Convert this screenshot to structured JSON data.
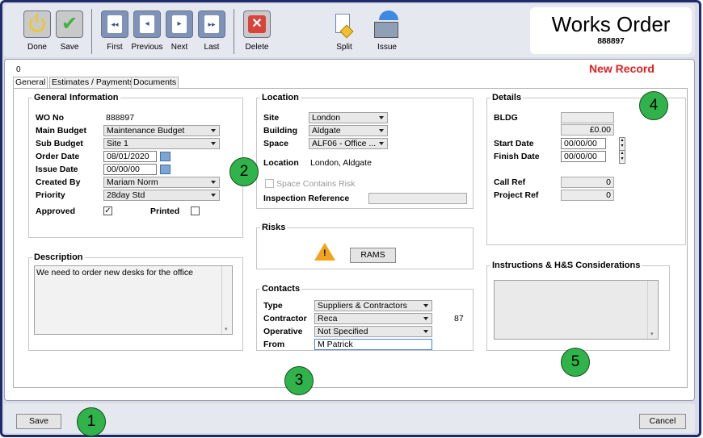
{
  "toolbar": {
    "done": "Done",
    "save": "Save",
    "first": "First",
    "previous": "Previous",
    "next": "Next",
    "last": "Last",
    "delete": "Delete",
    "split": "Split",
    "issue": "Issue"
  },
  "header": {
    "title": "Works Order",
    "number": "888897"
  },
  "record": {
    "tab_zero": "0",
    "status": "New Record"
  },
  "tabs": [
    "General",
    "Estimates / Payments",
    "Documents"
  ],
  "general": {
    "title": "General Information",
    "wo_no_label": "WO No",
    "wo_no": "888897",
    "main_budget_label": "Main Budget",
    "main_budget": "Maintenance Budget",
    "sub_budget_label": "Sub Budget",
    "sub_budget": "Site 1",
    "order_date_label": "Order Date",
    "order_date": "08/01/2020",
    "issue_date_label": "Issue Date",
    "issue_date": "00/00/00",
    "created_by_label": "Created By",
    "created_by": "Mariam Norm",
    "priority_label": "Priority",
    "priority": "28day Std",
    "approved_label": "Approved",
    "approved_mark": "✓",
    "printed_label": "Printed"
  },
  "description": {
    "title": "Description",
    "text": "We need to order new desks for the office"
  },
  "location": {
    "title": "Location",
    "site_label": "Site",
    "site": "London",
    "building_label": "Building",
    "building": "Aldgate",
    "space_label": "Space",
    "space": "ALF06 - Office ...",
    "location_label": "Location",
    "location": "London, Aldgate",
    "space_risk_label": "Space Contains Risk",
    "inspection_label": "Inspection Reference"
  },
  "risks": {
    "title": "Risks",
    "rams": "RAMS"
  },
  "contacts": {
    "title": "Contacts",
    "type_label": "Type",
    "type": "Suppliers & Contractors",
    "contractor_label": "Contractor",
    "contractor": "Reca",
    "contractor_no": "87",
    "operative_label": "Operative",
    "operative": "Not Specified",
    "from_label": "From",
    "from": "M Patrick"
  },
  "details": {
    "title": "Details",
    "bldg_label": "BLDG",
    "amount": "£0.00",
    "start_date_label": "Start Date",
    "start_date": "00/00/00",
    "finish_date_label": "Finish Date",
    "finish_date": "00/00/00",
    "call_ref_label": "Call Ref",
    "call_ref": "0",
    "project_ref_label": "Project Ref",
    "project_ref": "0"
  },
  "instructions": {
    "title": "Instructions & H&S Considerations"
  },
  "badges": [
    "1",
    "2",
    "3",
    "4",
    "5"
  ],
  "footer": {
    "save": "Save",
    "cancel": "Cancel"
  },
  "colors": {
    "accent_red": "#e02020",
    "badge_green": "#2fb34a",
    "frame_navy": "#1f2a6b"
  }
}
